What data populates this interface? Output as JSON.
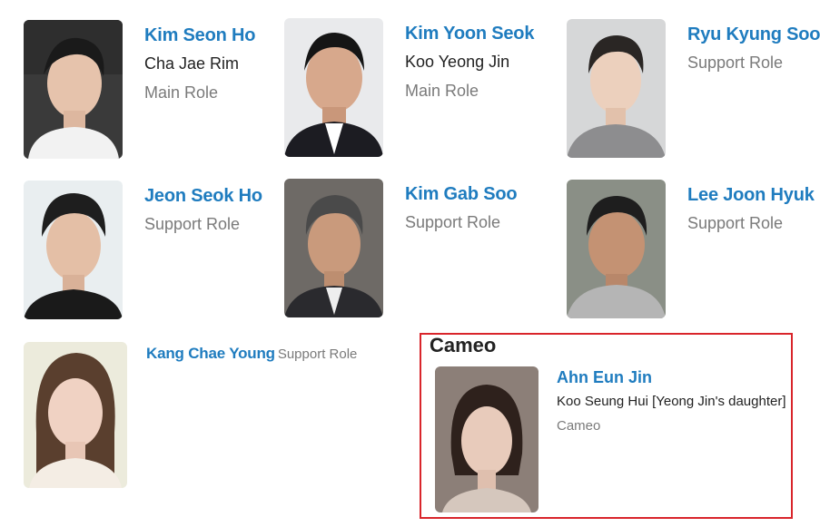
{
  "cast": [
    {
      "name": "Kim Seon Ho",
      "character": "Cha Jae Rim",
      "role": "Main Role",
      "photo_icon": "person-portrait"
    },
    {
      "name": "Kim Yoon Seok",
      "character": "Koo Yeong Jin",
      "role": "Main Role",
      "photo_icon": "person-portrait"
    },
    {
      "name": "Ryu Kyung Soo",
      "role": "Support Role",
      "photo_icon": "person-portrait"
    },
    {
      "name": "Jeon Seok Ho",
      "role": "Support Role",
      "photo_icon": "person-portrait"
    },
    {
      "name": "Kim Gab Soo",
      "role": "Support Role",
      "photo_icon": "person-portrait"
    },
    {
      "name": "Lee Joon Hyuk",
      "role": "Support Role",
      "photo_icon": "person-portrait"
    },
    {
      "name": "Kang Chae Young",
      "role": "Support Role",
      "photo_icon": "person-portrait"
    }
  ],
  "cameo": {
    "heading": "Cameo",
    "name": "Ahn Eun Jin",
    "character": "Koo Seung Hui [Yeong Jin's daughter]",
    "role": "Cameo",
    "photo_icon": "person-portrait"
  },
  "colors": {
    "link": "#1f7cbf",
    "highlight_border": "#d9252b",
    "role_text": "#7a7a7a"
  }
}
